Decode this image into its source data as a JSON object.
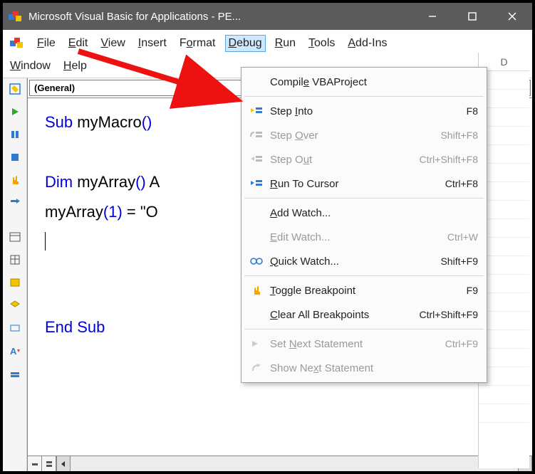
{
  "titlebar": {
    "title": "Microsoft Visual Basic for Applications - PE..."
  },
  "menus": {
    "file": "File",
    "edit": "Edit",
    "view": "View",
    "insert": "Insert",
    "format": "Format",
    "debug": "Debug",
    "run": "Run",
    "tools": "Tools",
    "addins": "Add-Ins",
    "window": "Window",
    "help": "Help"
  },
  "dropdowns": {
    "left": "(General)"
  },
  "code": {
    "line1a": "Sub",
    "line1b": " myMacro",
    "line1c": "()",
    "line2": "",
    "line3a": "Dim",
    "line3b": " myArray",
    "line3c": "()",
    "line3d": " A",
    "line4a": "myArray",
    "line4b": "(1)",
    "line4c": " = \"O",
    "line7a": "End Sub"
  },
  "debug_menu": {
    "compile": "Compile VBAProject",
    "step_into": "Step Into",
    "step_into_key": "F8",
    "step_over": "Step Over",
    "step_over_key": "Shift+F8",
    "step_out": "Step Out",
    "step_out_key": "Ctrl+Shift+F8",
    "run_to_cursor": "Run To Cursor",
    "run_to_cursor_key": "Ctrl+F8",
    "add_watch": "Add Watch...",
    "edit_watch": "Edit Watch...",
    "edit_watch_key": "Ctrl+W",
    "quick_watch": "Quick Watch...",
    "quick_watch_key": "Shift+F9",
    "toggle_bp": "Toggle Breakpoint",
    "toggle_bp_key": "F9",
    "clear_bp": "Clear All Breakpoints",
    "clear_bp_key": "Ctrl+Shift+F9",
    "set_next": "Set Next Statement",
    "set_next_key": "Ctrl+F9",
    "show_next": "Show Next Statement"
  },
  "sheet": {
    "col": "D"
  }
}
